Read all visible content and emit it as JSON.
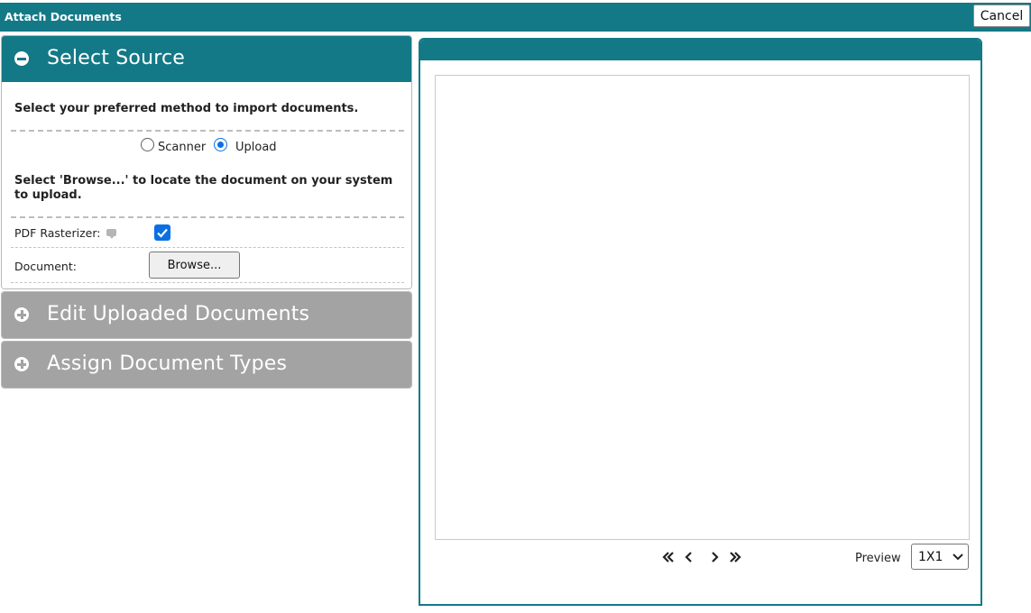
{
  "window": {
    "title": "Attach Documents",
    "cancel_label": "Cancel"
  },
  "accordion": {
    "select_source": {
      "title": "Select Source",
      "instruction_method": "Select your preferred method to import documents.",
      "radio_scanner_label": "Scanner",
      "radio_upload_label": "Upload",
      "selected_method": "Upload",
      "instruction_browse": "Select 'Browse...' to locate the document on your system to upload.",
      "pdf_rasterizer_label": "PDF Rasterizer:",
      "pdf_rasterizer_checked": true,
      "document_label": "Document:",
      "browse_label": "Browse..."
    },
    "edit_uploaded": {
      "title": "Edit Uploaded Documents"
    },
    "assign_types": {
      "title": "Assign Document Types"
    }
  },
  "preview": {
    "label": "Preview",
    "layout_value": "1X1",
    "nav": [
      "first-page-icon",
      "previous-page-icon",
      "next-page-icon",
      "last-page-icon"
    ]
  },
  "colors": {
    "accent": "#147987",
    "inactive_header": "#a3a3a3",
    "control_blue": "#0b6fe3"
  }
}
